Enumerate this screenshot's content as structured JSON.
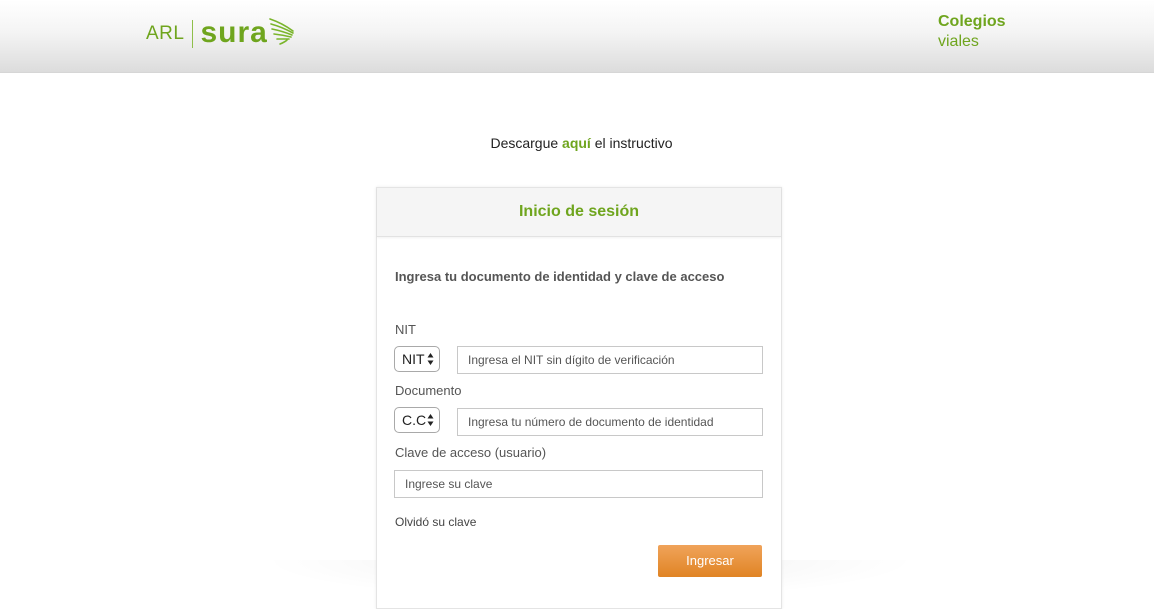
{
  "header": {
    "logo_arl": "ARL",
    "logo_sura": "sura",
    "title_line1": "Colegios",
    "title_line2": "viales"
  },
  "download": {
    "before": "Descargue ",
    "link": "aquí",
    "after": " el instructivo"
  },
  "login": {
    "title": "Inicio de sesión",
    "subtitle": "Ingresa tu documento de identidad y clave de acceso",
    "nit_label": "NIT",
    "nit_select_value": "NIT",
    "nit_placeholder": "Ingresa el NIT sin dígito de verificación",
    "document_label": "Documento",
    "document_select_value": "C.C",
    "document_placeholder": "Ingresa tu número de documento de identidad",
    "password_label": "Clave de acceso (usuario)",
    "password_placeholder": "Ingrese su clave",
    "forgot_link": "Olvidó su clave",
    "submit_label": "Ingresar"
  },
  "colors": {
    "brand_green": "#6fa51e",
    "button_orange": "#e8913a"
  },
  "icons": {
    "logo_wing": "wing-icon",
    "select_arrows": "up-down-arrows-icon"
  }
}
